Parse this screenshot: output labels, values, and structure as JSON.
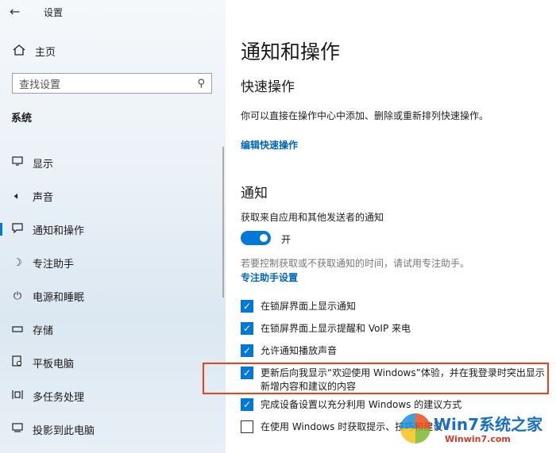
{
  "window": {
    "title": "设置",
    "back_icon": "back-arrow-icon"
  },
  "sidebar": {
    "home": {
      "label": "主页",
      "icon": "home-icon"
    },
    "search": {
      "placeholder": "查找设置",
      "icon": "search-icon"
    },
    "section": "系统",
    "items": [
      {
        "label": "显示",
        "icon": "monitor-icon"
      },
      {
        "label": "声音",
        "icon": "speaker-icon"
      },
      {
        "label": "通知和操作",
        "icon": "notification-icon",
        "active": true
      },
      {
        "label": "专注助手",
        "icon": "moon-icon"
      },
      {
        "label": "电源和睡眠",
        "icon": "power-icon"
      },
      {
        "label": "存储",
        "icon": "storage-icon"
      },
      {
        "label": "平板电脑",
        "icon": "tablet-icon"
      },
      {
        "label": "多任务处理",
        "icon": "multitask-icon"
      },
      {
        "label": "投影到此电脑",
        "icon": "project-icon"
      }
    ]
  },
  "main": {
    "title": "通知和操作",
    "quick": {
      "heading": "快速操作",
      "desc": "你可以直接在操作中心中添加、删除或重新排列快速操作。",
      "link": "编辑快速操作"
    },
    "notify": {
      "heading": "通知",
      "label": "获取来自应用和其他发送者的通知",
      "toggle_state": "开",
      "toggle_on": true,
      "hint": "若要控制获取或不获取通知的时间，请试用专注助手。",
      "hint_link": "专注助手设置"
    },
    "checkboxes": [
      {
        "label": "在锁屏界面上显示通知",
        "checked": true
      },
      {
        "label": "在锁屏界面上显示提醒和 VoIP 来电",
        "checked": true
      },
      {
        "label": "允许通知播放声音",
        "checked": true
      },
      {
        "label_line1": "更新后向我显示“欢迎使用 Windows”体验，并在我登录时突出显示",
        "label_line2": "新增内容和建议的内容",
        "checked": true
      },
      {
        "label": "完成设备设置以充分利用 Windows 的建议方式",
        "checked": true
      },
      {
        "label": "在使用 Windows 时获取提示、技巧和建议",
        "checked": false
      }
    ]
  },
  "watermark": {
    "brand": "Win7系统之家",
    "url": "Winwin7.com"
  },
  "colors": {
    "accent": "#0078d7",
    "link": "#0067b8",
    "highlight": "#e8431b"
  }
}
